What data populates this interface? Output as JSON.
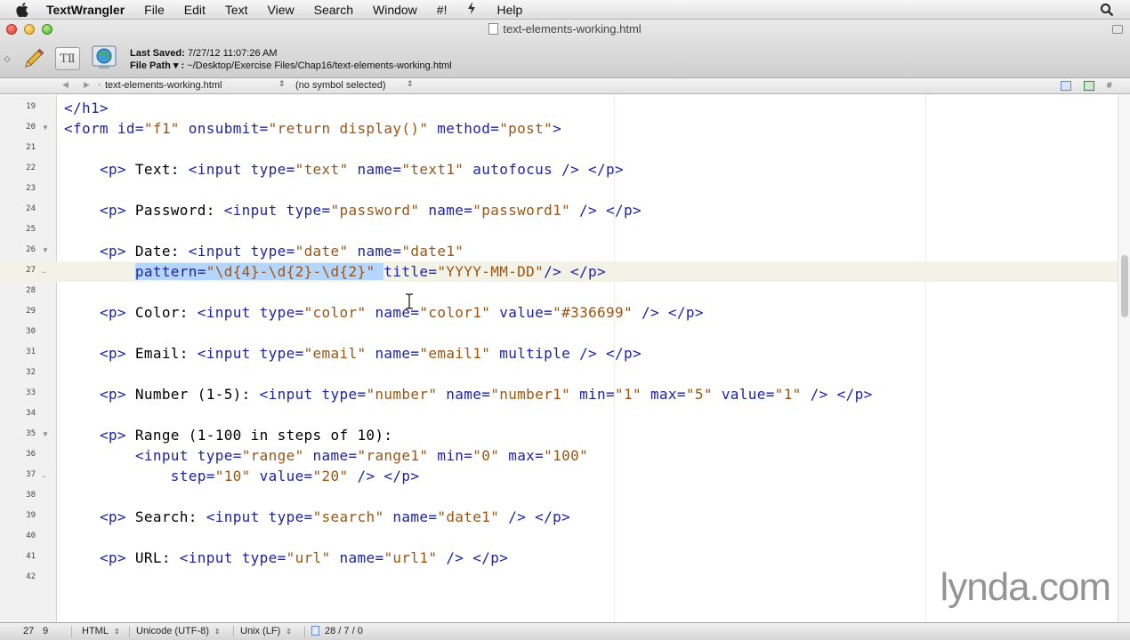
{
  "menubar": {
    "app_name": "TextWrangler",
    "items": [
      "File",
      "Edit",
      "Text",
      "View",
      "Search",
      "Window",
      "#!",
      "Help"
    ],
    "script_icon": "script-icon",
    "spotlight_icon": "spotlight-search-icon"
  },
  "window": {
    "title": "text-elements-working.html",
    "last_saved_label": "Last Saved:",
    "last_saved_value": "7/27/12 11:07:26 AM",
    "file_path_label": "File Path ▾ :",
    "file_path_value": "~/Desktop/Exercise Files/Chap16/text-elements-working.html",
    "text_tool_glyph": "TⅡ"
  },
  "navbar": {
    "current_file": "text-elements-working.html",
    "symbol": "(no symbol selected)"
  },
  "editor": {
    "current_line": 27,
    "lines": [
      {
        "n": "19",
        "fold": "",
        "code": [
          {
            "c": "tg",
            "t": "</h1>"
          }
        ]
      },
      {
        "n": "20",
        "fold": "start",
        "code": [
          {
            "c": "tg",
            "t": "<form "
          },
          {
            "c": "at",
            "t": "id="
          },
          {
            "c": "vl",
            "t": "\"f1\""
          },
          {
            "c": "at",
            "t": " onsubmit="
          },
          {
            "c": "vl",
            "t": "\"return display()\""
          },
          {
            "c": "at",
            "t": " method="
          },
          {
            "c": "vl",
            "t": "\"post\""
          },
          {
            "c": "tg",
            "t": ">"
          }
        ]
      },
      {
        "n": "21",
        "fold": "",
        "code": []
      },
      {
        "n": "22",
        "fold": "",
        "code": [
          {
            "c": "tx",
            "t": "    "
          },
          {
            "c": "tg",
            "t": "<p>"
          },
          {
            "c": "tx",
            "t": " Text: "
          },
          {
            "c": "tg",
            "t": "<input "
          },
          {
            "c": "at",
            "t": "type="
          },
          {
            "c": "vl",
            "t": "\"text\""
          },
          {
            "c": "at",
            "t": " name="
          },
          {
            "c": "vl",
            "t": "\"text1\""
          },
          {
            "c": "at",
            "t": " autofocus "
          },
          {
            "c": "tg",
            "t": "/> </p>"
          }
        ]
      },
      {
        "n": "23",
        "fold": "",
        "code": []
      },
      {
        "n": "24",
        "fold": "",
        "code": [
          {
            "c": "tx",
            "t": "    "
          },
          {
            "c": "tg",
            "t": "<p>"
          },
          {
            "c": "tx",
            "t": " Password: "
          },
          {
            "c": "tg",
            "t": "<input "
          },
          {
            "c": "at",
            "t": "type="
          },
          {
            "c": "vl",
            "t": "\"password\""
          },
          {
            "c": "at",
            "t": " name="
          },
          {
            "c": "vl",
            "t": "\"password1\""
          },
          {
            "c": "tg",
            "t": " /> </p>"
          }
        ]
      },
      {
        "n": "25",
        "fold": "",
        "code": []
      },
      {
        "n": "26",
        "fold": "start",
        "code": [
          {
            "c": "tx",
            "t": "    "
          },
          {
            "c": "tg",
            "t": "<p>"
          },
          {
            "c": "tx",
            "t": " Date: "
          },
          {
            "c": "tg",
            "t": "<input "
          },
          {
            "c": "at",
            "t": "type="
          },
          {
            "c": "vl",
            "t": "\"date\""
          },
          {
            "c": "at",
            "t": " name="
          },
          {
            "c": "vl",
            "t": "\"date1\""
          }
        ]
      },
      {
        "n": "27",
        "fold": "end",
        "code": [
          {
            "c": "tx",
            "t": "        "
          },
          {
            "c": "hl at",
            "t": "pattern="
          },
          {
            "c": "hl vl",
            "t": "\"\\d{4}-\\d{2}-\\d{2}\" "
          },
          {
            "c": "at",
            "t": "title="
          },
          {
            "c": "vl",
            "t": "\"YYYY-MM-DD\""
          },
          {
            "c": "tg",
            "t": "/> </p>"
          }
        ]
      },
      {
        "n": "28",
        "fold": "",
        "code": []
      },
      {
        "n": "29",
        "fold": "",
        "code": [
          {
            "c": "tx",
            "t": "    "
          },
          {
            "c": "tg",
            "t": "<p>"
          },
          {
            "c": "tx",
            "t": " Color: "
          },
          {
            "c": "tg",
            "t": "<input "
          },
          {
            "c": "at",
            "t": "type="
          },
          {
            "c": "vl",
            "t": "\"color\""
          },
          {
            "c": "at",
            "t": " name="
          },
          {
            "c": "vl",
            "t": "\"color1\""
          },
          {
            "c": "at",
            "t": " value="
          },
          {
            "c": "vl",
            "t": "\"#336699\""
          },
          {
            "c": "tg",
            "t": " /> </p>"
          }
        ]
      },
      {
        "n": "30",
        "fold": "",
        "code": []
      },
      {
        "n": "31",
        "fold": "",
        "code": [
          {
            "c": "tx",
            "t": "    "
          },
          {
            "c": "tg",
            "t": "<p>"
          },
          {
            "c": "tx",
            "t": " Email: "
          },
          {
            "c": "tg",
            "t": "<input "
          },
          {
            "c": "at",
            "t": "type="
          },
          {
            "c": "vl",
            "t": "\"email\""
          },
          {
            "c": "at",
            "t": " name="
          },
          {
            "c": "vl",
            "t": "\"email1\""
          },
          {
            "c": "at",
            "t": " multiple "
          },
          {
            "c": "tg",
            "t": "/> </p>"
          }
        ]
      },
      {
        "n": "32",
        "fold": "",
        "code": []
      },
      {
        "n": "33",
        "fold": "",
        "code": [
          {
            "c": "tx",
            "t": "    "
          },
          {
            "c": "tg",
            "t": "<p>"
          },
          {
            "c": "tx",
            "t": " Number (1-5): "
          },
          {
            "c": "tg",
            "t": "<input "
          },
          {
            "c": "at",
            "t": "type="
          },
          {
            "c": "vl",
            "t": "\"number\""
          },
          {
            "c": "at",
            "t": " name="
          },
          {
            "c": "vl",
            "t": "\"number1\""
          },
          {
            "c": "at",
            "t": " min="
          },
          {
            "c": "vl",
            "t": "\"1\""
          },
          {
            "c": "at",
            "t": " max="
          },
          {
            "c": "vl",
            "t": "\"5\""
          },
          {
            "c": "at",
            "t": " value="
          },
          {
            "c": "vl",
            "t": "\"1\""
          },
          {
            "c": "tg",
            "t": " /> </p>"
          }
        ]
      },
      {
        "n": "34",
        "fold": "",
        "code": []
      },
      {
        "n": "35",
        "fold": "start",
        "code": [
          {
            "c": "tx",
            "t": "    "
          },
          {
            "c": "tg",
            "t": "<p>"
          },
          {
            "c": "tx",
            "t": " Range (1-100 in steps of 10):"
          }
        ]
      },
      {
        "n": "36",
        "fold": "",
        "code": [
          {
            "c": "tx",
            "t": "        "
          },
          {
            "c": "tg",
            "t": "<input "
          },
          {
            "c": "at",
            "t": "type="
          },
          {
            "c": "vl",
            "t": "\"range\""
          },
          {
            "c": "at",
            "t": " name="
          },
          {
            "c": "vl",
            "t": "\"range1\""
          },
          {
            "c": "at",
            "t": " min="
          },
          {
            "c": "vl",
            "t": "\"0\""
          },
          {
            "c": "at",
            "t": " max="
          },
          {
            "c": "vl",
            "t": "\"100\""
          }
        ]
      },
      {
        "n": "37",
        "fold": "end",
        "code": [
          {
            "c": "tx",
            "t": "            "
          },
          {
            "c": "at",
            "t": "step="
          },
          {
            "c": "vl",
            "t": "\"10\""
          },
          {
            "c": "at",
            "t": " value="
          },
          {
            "c": "vl",
            "t": "\"20\""
          },
          {
            "c": "tg",
            "t": " /> </p>"
          }
        ]
      },
      {
        "n": "38",
        "fold": "",
        "code": []
      },
      {
        "n": "39",
        "fold": "",
        "code": [
          {
            "c": "tx",
            "t": "    "
          },
          {
            "c": "tg",
            "t": "<p>"
          },
          {
            "c": "tx",
            "t": " Search: "
          },
          {
            "c": "tg",
            "t": "<input "
          },
          {
            "c": "at",
            "t": "type="
          },
          {
            "c": "vl",
            "t": "\"search\""
          },
          {
            "c": "at",
            "t": " name="
          },
          {
            "c": "vl",
            "t": "\"date1\""
          },
          {
            "c": "tg",
            "t": " /> </p>"
          }
        ]
      },
      {
        "n": "40",
        "fold": "",
        "code": []
      },
      {
        "n": "41",
        "fold": "",
        "code": [
          {
            "c": "tx",
            "t": "    "
          },
          {
            "c": "tg",
            "t": "<p>"
          },
          {
            "c": "tx",
            "t": " URL: "
          },
          {
            "c": "tg",
            "t": "<input "
          },
          {
            "c": "at",
            "t": "type="
          },
          {
            "c": "vl",
            "t": "\"url\""
          },
          {
            "c": "at",
            "t": " name="
          },
          {
            "c": "vl",
            "t": "\"url1\""
          },
          {
            "c": "tg",
            "t": " /> </p>"
          }
        ]
      },
      {
        "n": "42",
        "fold": "",
        "code": []
      }
    ]
  },
  "watermark": "lynda.com",
  "statusbar": {
    "line": "27",
    "column": "9",
    "language": "HTML",
    "encoding": "Unicode (UTF-8)",
    "line_endings": "Unix (LF)",
    "counts": "28 / 7 / 0"
  },
  "colors": {
    "tag": "#1d22a6",
    "attribute_value": "#9a5512",
    "selection": "#b6d5fb",
    "current_line": "#f2f2e6"
  }
}
